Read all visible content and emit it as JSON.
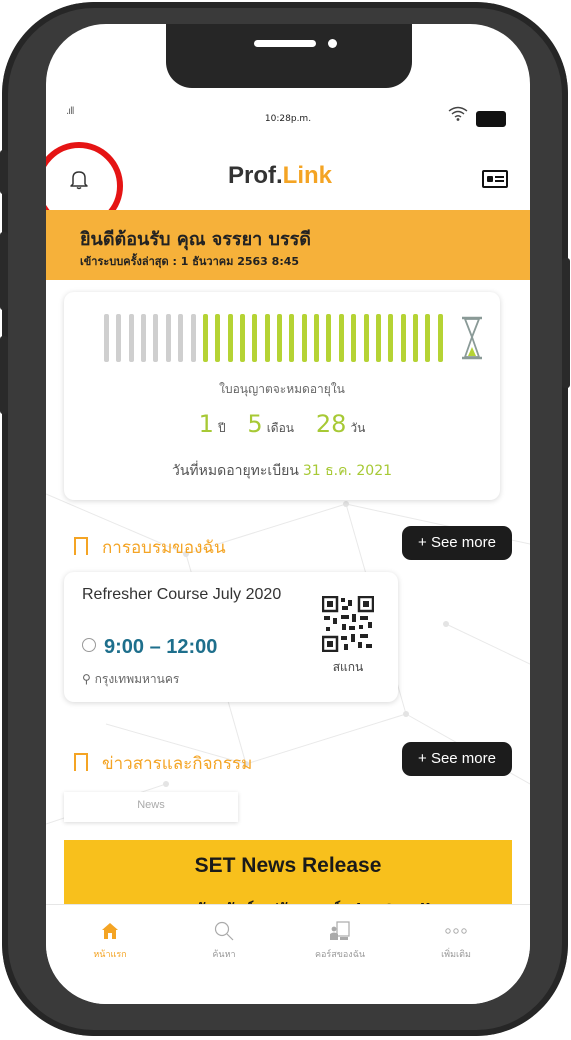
{
  "status_bar": {
    "time": "10:28p.m.",
    "signal": ".ıll"
  },
  "header": {
    "logo_prefix": "Prof",
    "logo_dot": ".",
    "logo_accent": "Link"
  },
  "welcome": {
    "greeting": "ยินดีต้อนรับ คุณ จรรยา บรรดี",
    "last_login": "เข้าระบบครั้งล่าสุด : 1 ธันวาคม 2563 8:45"
  },
  "license": {
    "caption": "ใบอนุญาตจะหมดอายุใน",
    "years": "1",
    "years_unit": "ปี",
    "months": "5",
    "months_unit": "เดือน",
    "days": "28",
    "days_unit": "วัน",
    "expiry_label": "วันที่หมดอายุทะเบียน",
    "expiry_date": "31 ธ.ค. 2021",
    "progress_total_bars": 28,
    "progress_remaining_bars": 20
  },
  "training": {
    "title": "การอบรมของฉัน",
    "see_more": "+ See more",
    "course": {
      "title": "Refresher Course July 2020",
      "time": "9:00 – 12:00",
      "location": "กรุงเทพมหานคร",
      "scan_label": "สแกน"
    }
  },
  "news": {
    "title": "ข่าวสารและกิจกรรม",
    "see_more": "+ See more",
    "tab_label": "News",
    "headline": "SET News Release",
    "subline": "ตลาดหลักทรัพย์ฯ ปรับเกณฑ์ short sell"
  },
  "tabbar": {
    "items": [
      {
        "label": "หน้าแรก",
        "icon": "home-icon"
      },
      {
        "label": "ค้นหา",
        "icon": "search-icon"
      },
      {
        "label": "คอร์สของฉัน",
        "icon": "course-icon"
      },
      {
        "label": "เพิ่มเติม",
        "icon": "more-icon"
      }
    ]
  },
  "colors": {
    "accent": "#f4a424",
    "banner": "#f6b13a",
    "remaining_bar": "#b5d334",
    "elapsed_bar": "#cfcfcf",
    "time_text": "#1e6f8c",
    "highlight_circle": "#e51414"
  }
}
